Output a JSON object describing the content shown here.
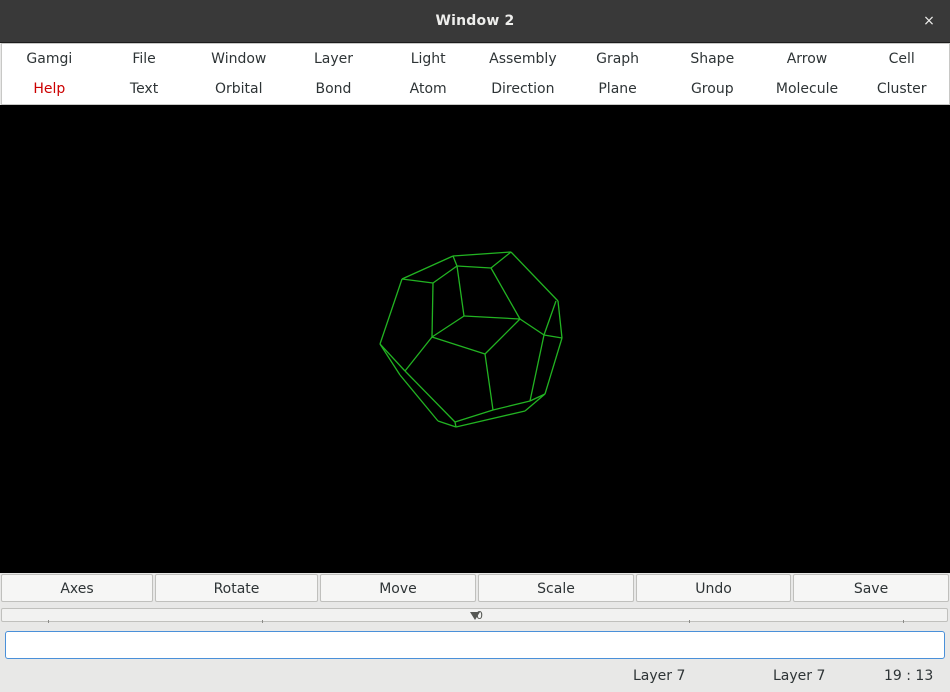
{
  "window": {
    "title": "Window 2",
    "close_glyph": "×"
  },
  "menubar": {
    "row1": [
      "Gamgi",
      "File",
      "Window",
      "Layer",
      "Light",
      "Assembly",
      "Graph",
      "Shape",
      "Arrow",
      "Cell"
    ],
    "row2": [
      "Help",
      "Text",
      "Orbital",
      "Bond",
      "Atom",
      "Direction",
      "Plane",
      "Group",
      "Molecule",
      "Cluster"
    ],
    "highlighted_item": "Help",
    "highlight_color": "#cc0000"
  },
  "viewport": {
    "background": "#000000",
    "wire_color": "#22b322",
    "object": "dodecahedron-wireframe"
  },
  "toolbar": {
    "axes_label": "Axes",
    "rotate_label": "Rotate",
    "move_label": "Move",
    "scale_label": "Scale",
    "undo_label": "Undo",
    "save_label": "Save"
  },
  "slider": {
    "value_label": "0",
    "value": 0
  },
  "command": {
    "value": ""
  },
  "statusbar": {
    "layer_left": "Layer 7",
    "layer_right": "Layer 7",
    "time": "19 : 13"
  },
  "icons": {
    "close": "close-icon",
    "slider_thumb": "slider-thumb-icon"
  }
}
